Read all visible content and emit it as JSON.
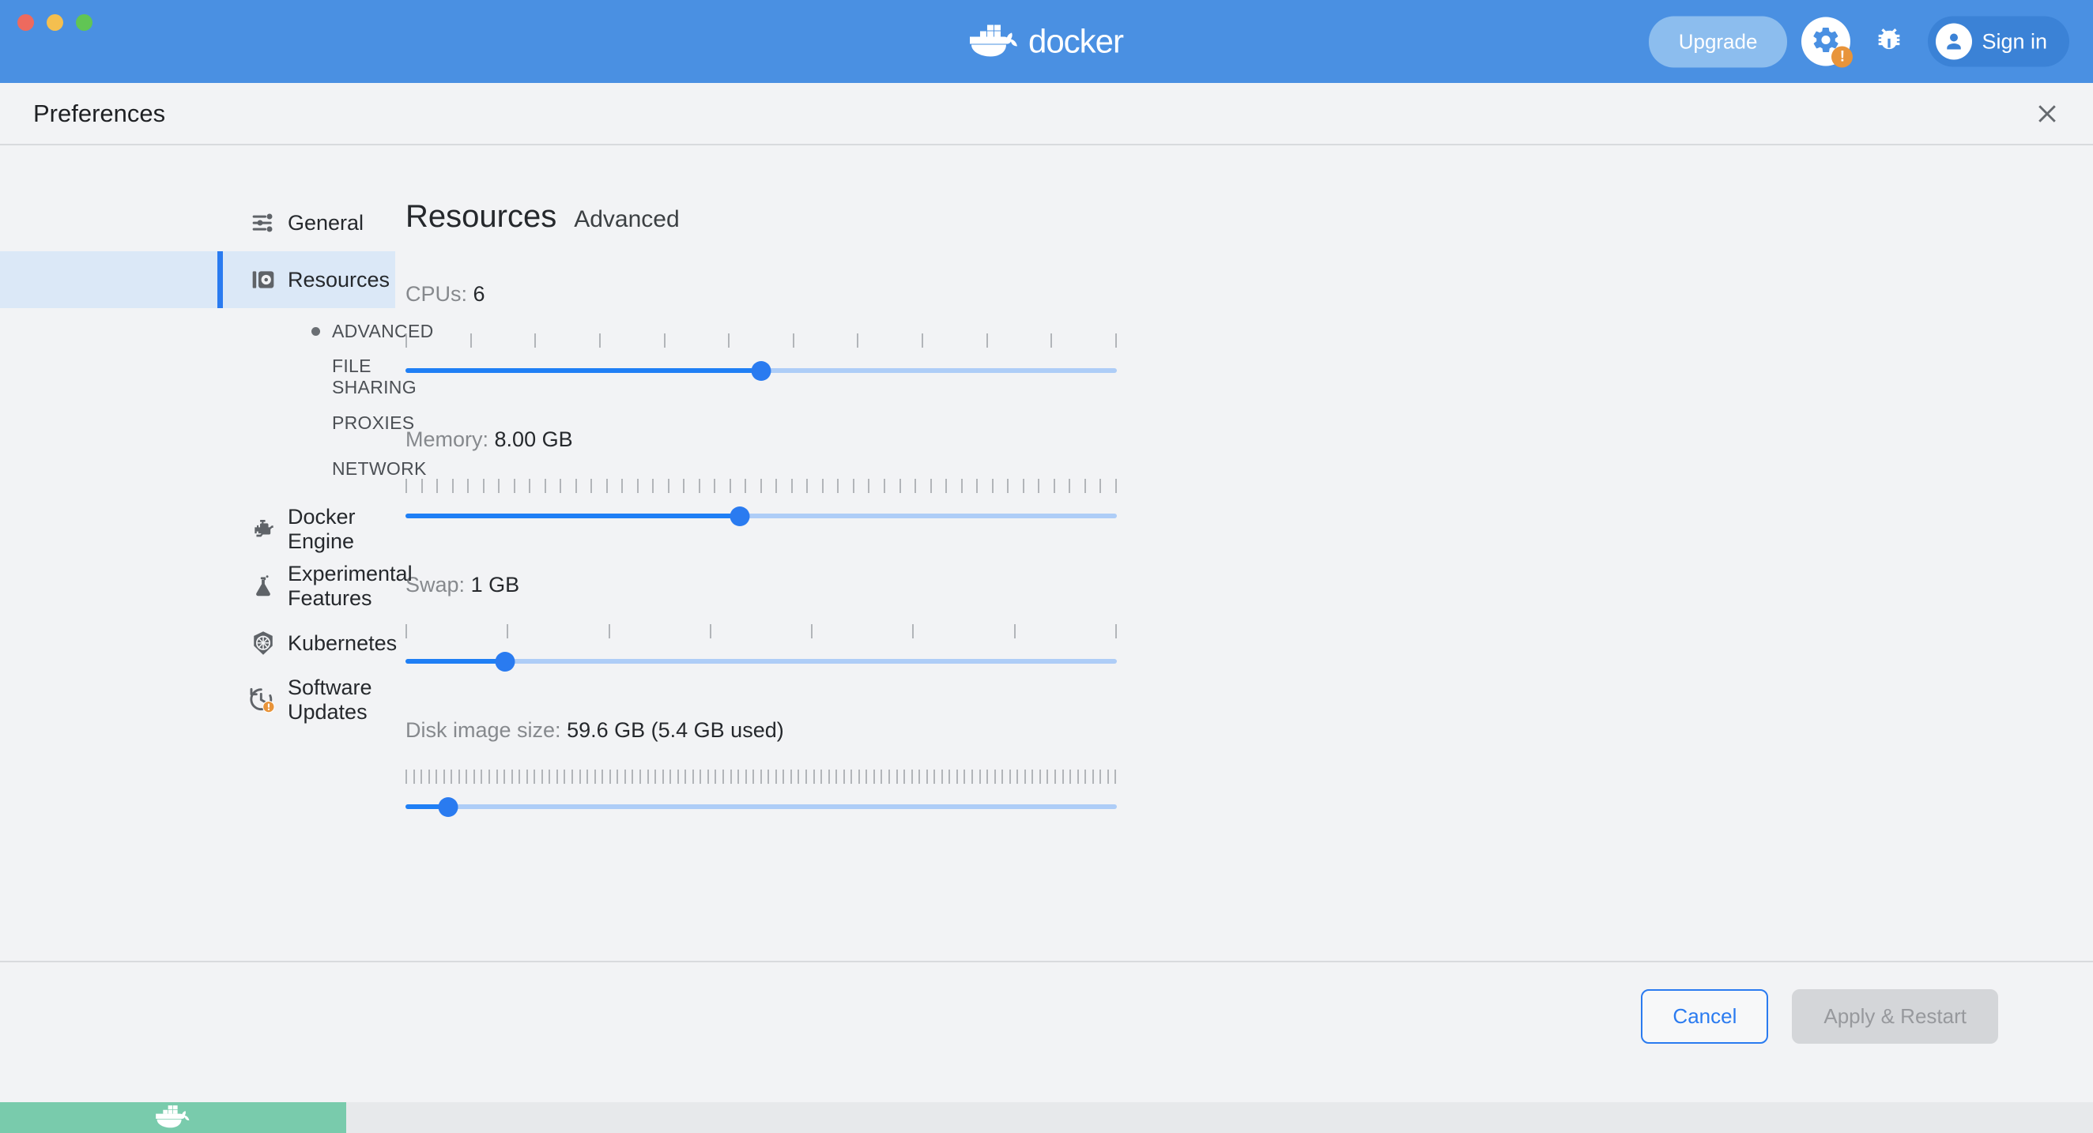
{
  "titlebar": {
    "brand": "docker",
    "upgrade_label": "Upgrade",
    "signin_label": "Sign in",
    "settings_icon": "gear-icon",
    "settings_badge": "!",
    "bug_icon": "bug-icon",
    "avatar_icon": "user-avatar-icon",
    "bg_color": "#4a90e2"
  },
  "header": {
    "title": "Preferences",
    "close_icon": "close-icon"
  },
  "sidebar": {
    "items": [
      {
        "label": "General",
        "icon": "sliders-icon",
        "active": false
      },
      {
        "label": "Resources",
        "icon": "resources-icon",
        "active": true
      },
      {
        "label": "Docker Engine",
        "icon": "engine-icon",
        "active": false
      },
      {
        "label": "Experimental Features",
        "icon": "flask-icon",
        "active": false
      },
      {
        "label": "Kubernetes",
        "icon": "kubernetes-helm-icon",
        "active": false
      },
      {
        "label": "Software Updates",
        "icon": "update-clock-icon",
        "active": false,
        "badge": "!"
      }
    ],
    "sub_items": [
      {
        "label": "ADVANCED",
        "selected": true
      },
      {
        "label": "FILE SHARING",
        "selected": false
      },
      {
        "label": "PROXIES",
        "selected": false
      },
      {
        "label": "NETWORK",
        "selected": false
      }
    ]
  },
  "main": {
    "heading": "Resources",
    "subheading": "Advanced",
    "sliders": [
      {
        "name": "cpus",
        "label": "CPUs:",
        "value": "6",
        "ticks": 12,
        "percent": 50
      },
      {
        "name": "memory",
        "label": "Memory:",
        "value": "8.00 GB",
        "ticks": 47,
        "percent": 47
      },
      {
        "name": "swap",
        "label": "Swap:",
        "value": "1 GB",
        "ticks": 8,
        "percent": 14
      },
      {
        "name": "disk-image-size",
        "label": "Disk image size:",
        "value": "59.6 GB (5.4 GB used)",
        "ticks": 95,
        "percent": 6
      }
    ]
  },
  "footer": {
    "cancel_label": "Cancel",
    "apply_label": "Apply & Restart"
  },
  "statusbar": {
    "whale_icon": "docker-whale-icon",
    "color": "#79cbac"
  },
  "colors": {
    "accent_blue": "#2a7bf0",
    "titlebar_blue": "#4a90e2",
    "warning_orange": "#e8943a",
    "status_green": "#79cbac"
  }
}
